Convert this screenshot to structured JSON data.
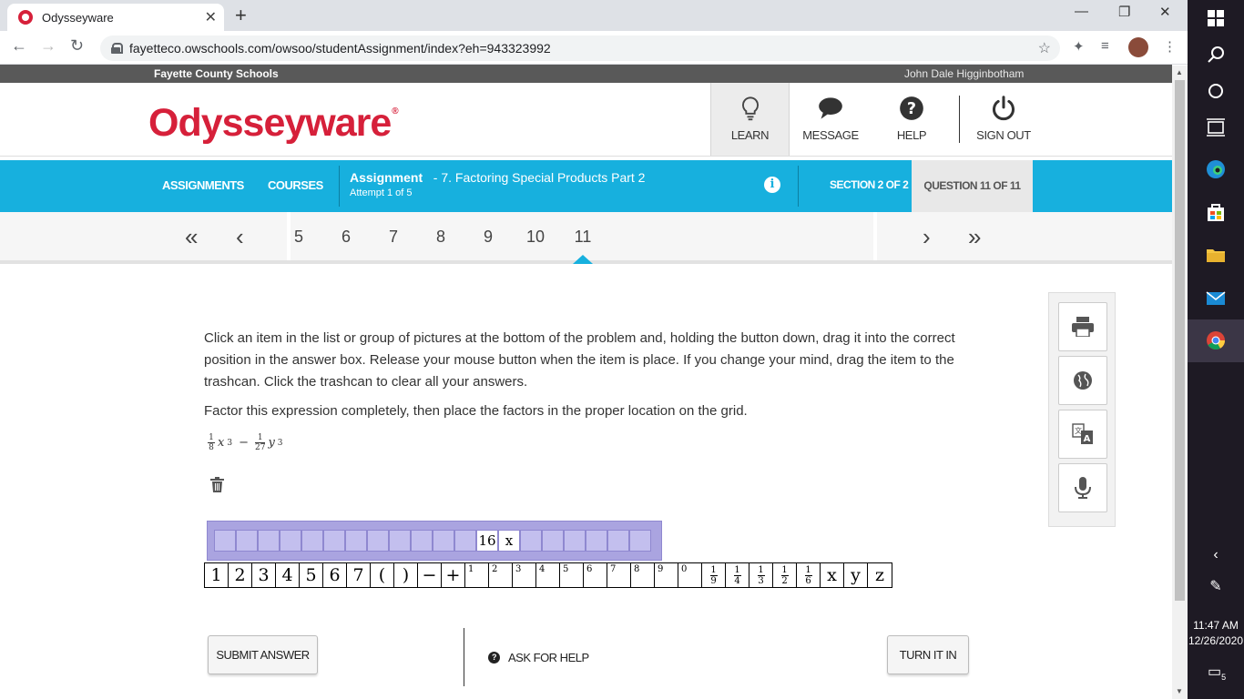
{
  "browser": {
    "tab_title": "Odysseyware",
    "tab_close": "✕",
    "new_tab": "+",
    "url": "fayetteco.owschools.com/owsoo/studentAssignment/index?eh=943323992",
    "win_minimize": "—",
    "win_restore": "❐",
    "win_close": "✕"
  },
  "site": {
    "school": "Fayette County Schools",
    "user": "John Dale Higginbotham",
    "logo": "Odysseyware",
    "logo_mark": "®",
    "header_buttons": {
      "learn": "LEARN",
      "message": "MESSAGE",
      "help": "HELP",
      "signout": "SIGN OUT"
    }
  },
  "bluebar": {
    "assignments": "ASSIGNMENTS",
    "courses": "COURSES",
    "assignment_label": "Assignment",
    "assignment_name": "- 7. Factoring Special Products Part 2",
    "attempt": "Attempt 1 of 5",
    "info": "i",
    "section": "SECTION 2 OF 2",
    "question": "QUESTION 11 OF 11"
  },
  "qnav": {
    "first": "«",
    "prev": "‹",
    "next": "›",
    "last": "»",
    "numbers": [
      "5",
      "6",
      "7",
      "8",
      "9",
      "10",
      "11"
    ],
    "active": "11"
  },
  "question": {
    "instructions": "Click an item in the list or group of pictures at the bottom of the problem and, holding the button down, drag it into the correct position in the answer box. Release your mouse button when the item is place. If you change your mind, drag the item to the trashcan. Click the trashcan to clear all your answers.",
    "prompt": "Factor this expression completely, then place the factors in the proper location on the grid.",
    "expression": {
      "frac1_num": "1",
      "frac1_den": "8",
      "var1": "x",
      "exp1": "3",
      "op": "−",
      "frac2_num": "1",
      "frac2_den": "27",
      "var2": "y",
      "exp2": "3"
    },
    "answer_cells_total": 20,
    "answer_filled": [
      {
        "index": 12,
        "type": "frac",
        "num": "1",
        "den": "6"
      },
      {
        "index": 13,
        "type": "text",
        "value": "x"
      }
    ],
    "palette": [
      {
        "type": "text",
        "value": "1"
      },
      {
        "type": "text",
        "value": "2"
      },
      {
        "type": "text",
        "value": "3"
      },
      {
        "type": "text",
        "value": "4"
      },
      {
        "type": "text",
        "value": "5"
      },
      {
        "type": "text",
        "value": "6"
      },
      {
        "type": "text",
        "value": "7"
      },
      {
        "type": "text",
        "value": "("
      },
      {
        "type": "text",
        "value": ")"
      },
      {
        "type": "text",
        "value": "−"
      },
      {
        "type": "text",
        "value": "+"
      },
      {
        "type": "sup",
        "value": "1"
      },
      {
        "type": "sup",
        "value": "2"
      },
      {
        "type": "sup",
        "value": "3"
      },
      {
        "type": "sup",
        "value": "4"
      },
      {
        "type": "sup",
        "value": "5"
      },
      {
        "type": "sup",
        "value": "6"
      },
      {
        "type": "sup",
        "value": "7"
      },
      {
        "type": "sup",
        "value": "8"
      },
      {
        "type": "sup",
        "value": "9"
      },
      {
        "type": "sup",
        "value": "0"
      },
      {
        "type": "frac",
        "num": "1",
        "den": "9"
      },
      {
        "type": "frac",
        "num": "1",
        "den": "4"
      },
      {
        "type": "frac",
        "num": "1",
        "den": "3"
      },
      {
        "type": "frac",
        "num": "1",
        "den": "2"
      },
      {
        "type": "frac",
        "num": "1",
        "den": "6"
      },
      {
        "type": "text",
        "value": "x"
      },
      {
        "type": "text",
        "value": "y"
      },
      {
        "type": "text",
        "value": "z"
      }
    ]
  },
  "tools": [
    "print-icon",
    "globe-icon",
    "translate-icon",
    "microphone-icon"
  ],
  "footer": {
    "submit": "SUBMIT ANSWER",
    "ask_help": "ASK FOR HELP",
    "ask_help_icon": "?",
    "turn_in": "TURN IT IN"
  },
  "taskbar": {
    "time": "11:47 AM",
    "date": "12/26/2020",
    "notifications": "5"
  },
  "colors": {
    "brand_red": "#d6203a",
    "accent_blue": "#17b0de",
    "answer_purple": "#aaa4e0"
  }
}
